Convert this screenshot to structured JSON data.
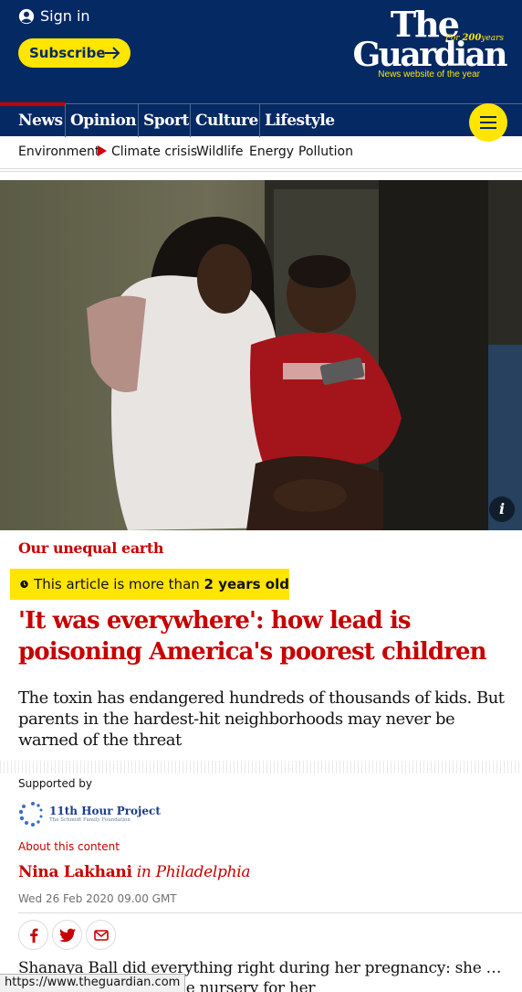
{
  "header": {
    "signin_label": "Sign in",
    "subscribe_label": "Subscribe",
    "logo_the": "The",
    "logo_guardian": "Guardian",
    "logo_for": "For",
    "logo_years_number": "200",
    "logo_years": "years",
    "logo_tagline": "News website of the year"
  },
  "nav": {
    "items": [
      {
        "label": "News"
      },
      {
        "label": "Opinion"
      },
      {
        "label": "Sport"
      },
      {
        "label": "Culture"
      },
      {
        "label": "Lifestyle"
      }
    ]
  },
  "subnav": {
    "items": [
      {
        "label": "Environment"
      },
      {
        "label": "Climate crisis"
      },
      {
        "label": "Wildlife"
      },
      {
        "label": "Energy"
      },
      {
        "label": "Pollution"
      }
    ]
  },
  "article": {
    "info_label": "i",
    "series": "Our unequal earth",
    "age_prefix": "This article is more than ",
    "age_value": "2 years old",
    "headline": "'It was everywhere': how lead is poisoning America's poorest children",
    "standfirst": "The toxin has endangered hundreds of thousands of kids. But parents in the hardest-hit neighborhoods may never be warned of the threat",
    "supported_by": "Supported by",
    "sponsor_name": "11th Hour Project",
    "sponsor_sub": "The Schmidt Family Foundation",
    "about_link": "About this content",
    "author": "Nina Lakhani",
    "location": "in Philadelphia",
    "date": "Wed 26 Feb 2020 09.00 GMT",
    "body_start": "Shanaya Ball did everything right during her pregnancy: she … well, and kitted out the nursery for her"
  },
  "status": {
    "url": "https://www.theguardian.com"
  },
  "colors": {
    "brand_blue": "#052962",
    "accent_yellow": "#ffe500",
    "news_red": "#c70000"
  }
}
